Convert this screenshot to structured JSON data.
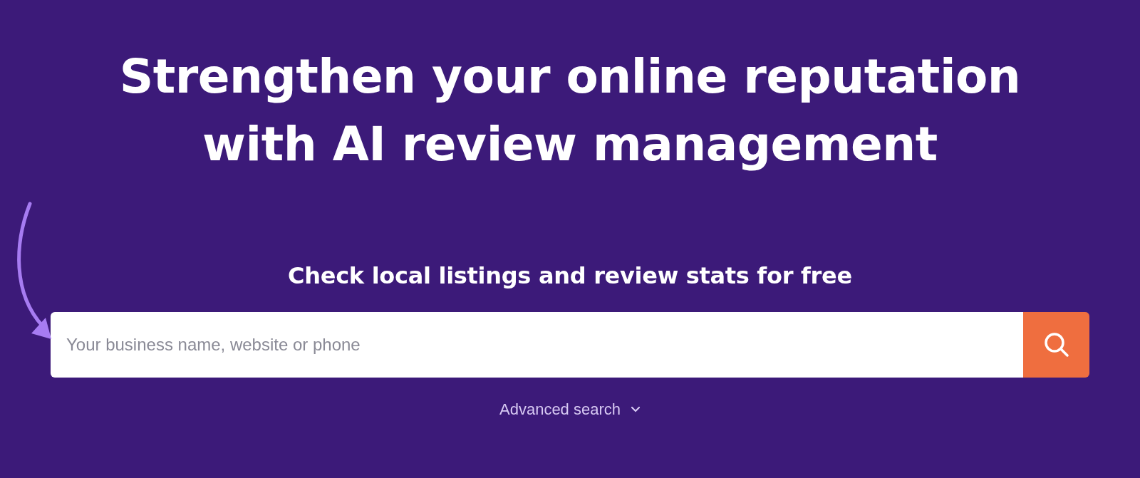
{
  "headline_lines": [
    "Strengthen your online reputation",
    "with AI review management"
  ],
  "subheading": "Check local listings and review stats for free",
  "search": {
    "placeholder": "Your business name, website or phone"
  },
  "advanced_search": {
    "label": "Advanced search",
    "expanded": false
  }
}
